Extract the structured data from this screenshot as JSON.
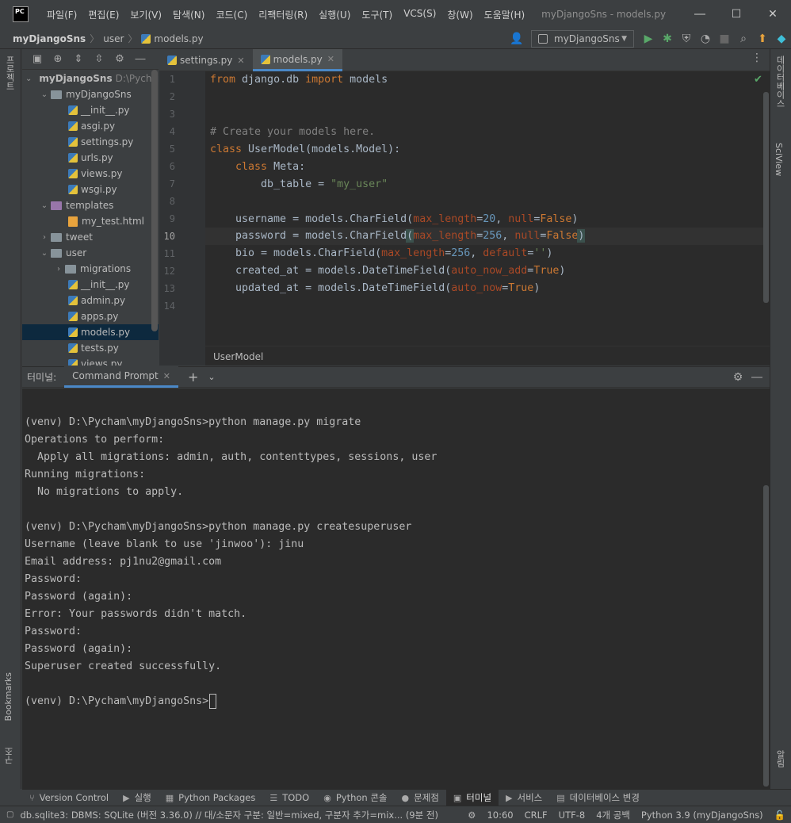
{
  "window": {
    "logo": "PC",
    "title": "myDjangoSns - models.py",
    "menu": [
      "파일(F)",
      "편집(E)",
      "보기(V)",
      "탐색(N)",
      "코드(C)",
      "리팩터링(R)",
      "실행(U)",
      "도구(T)",
      "VCS(S)",
      "창(W)",
      "도움말(H)"
    ]
  },
  "navbar": {
    "crumbs": [
      "myDjangoSns",
      "user",
      "models.py"
    ],
    "run_config": "myDjangoSns"
  },
  "left_strip": {
    "top": "프로젝트",
    "bookmarks": "Bookmarks",
    "structure": "구조"
  },
  "right_strip": {
    "db": "데이터베이스",
    "sciview": "SciView",
    "notifications": "알림"
  },
  "project": {
    "root_name": "myDjangoSns",
    "root_path": "D:\\Pycham\\myDjangoSns",
    "items": [
      {
        "label": "myDjangoSns",
        "type": "folder",
        "depth": 1,
        "arrow": "open"
      },
      {
        "label": "__init__.py",
        "type": "py",
        "depth": 2
      },
      {
        "label": "asgi.py",
        "type": "py",
        "depth": 2
      },
      {
        "label": "settings.py",
        "type": "py",
        "depth": 2
      },
      {
        "label": "urls.py",
        "type": "py",
        "depth": 2
      },
      {
        "label": "views.py",
        "type": "py",
        "depth": 2
      },
      {
        "label": "wsgi.py",
        "type": "py",
        "depth": 2
      },
      {
        "label": "templates",
        "type": "template-folder",
        "depth": 1,
        "arrow": "open"
      },
      {
        "label": "my_test.html",
        "type": "html",
        "depth": 2
      },
      {
        "label": "tweet",
        "type": "folder",
        "depth": 1,
        "arrow": "closed"
      },
      {
        "label": "user",
        "type": "folder",
        "depth": 1,
        "arrow": "open"
      },
      {
        "label": "migrations",
        "type": "folder",
        "depth": 2,
        "arrow": "closed"
      },
      {
        "label": "__init__.py",
        "type": "py",
        "depth": 2
      },
      {
        "label": "admin.py",
        "type": "py",
        "depth": 2
      },
      {
        "label": "apps.py",
        "type": "py",
        "depth": 2
      },
      {
        "label": "models.py",
        "type": "py",
        "depth": 2,
        "selected": true
      },
      {
        "label": "tests.py",
        "type": "py",
        "depth": 2
      },
      {
        "label": "views.py",
        "type": "py",
        "depth": 2
      }
    ]
  },
  "editor": {
    "tabs": [
      {
        "label": "settings.py",
        "active": false
      },
      {
        "label": "models.py",
        "active": true
      }
    ],
    "current_line": 10,
    "line_numbers": [
      "1",
      "2",
      "3",
      "4",
      "5",
      "6",
      "7",
      "8",
      "9",
      "10",
      "11",
      "12",
      "13",
      "14"
    ],
    "breadcrumb": "UserModel"
  },
  "terminal": {
    "title": "터미널:",
    "tab": "Command Prompt",
    "lines": [
      "",
      "(venv) D:\\Pycham\\myDjangoSns>python manage.py migrate",
      "Operations to perform:",
      "  Apply all migrations: admin, auth, contenttypes, sessions, user",
      "Running migrations:",
      "  No migrations to apply.",
      "",
      "(venv) D:\\Pycham\\myDjangoSns>python manage.py createsuperuser",
      "Username (leave blank to use 'jinwoo'): jinu",
      "Email address: pj1nu2@gmail.com",
      "Password:",
      "Password (again):",
      "Error: Your passwords didn't match.",
      "Password:",
      "Password (again):",
      "Superuser created successfully.",
      "",
      "(venv) D:\\Pycham\\myDjangoSns>"
    ]
  },
  "bottom_tabs": [
    {
      "label": "Version Control",
      "icon": "⑂"
    },
    {
      "label": "실행",
      "icon": "▶"
    },
    {
      "label": "Python Packages",
      "icon": "▦"
    },
    {
      "label": "TODO",
      "icon": "☰"
    },
    {
      "label": "Python 콘솔",
      "icon": "◉"
    },
    {
      "label": "문제점",
      "icon": "●"
    },
    {
      "label": "터미널",
      "icon": "▣",
      "active": true
    },
    {
      "label": "서비스",
      "icon": "▶"
    },
    {
      "label": "데이터베이스 변경",
      "icon": "▤"
    }
  ],
  "status": {
    "message": "db.sqlite3: DBMS: SQLite (버전 3.36.0) // 대/소문자 구분: 일반=mixed, 구분자 추가=mix... (9분 전)",
    "time": "10:60",
    "line_sep": "CRLF",
    "encoding": "UTF-8",
    "indent": "4개 공백",
    "interpreter": "Python 3.9 (myDjangoSns)"
  }
}
